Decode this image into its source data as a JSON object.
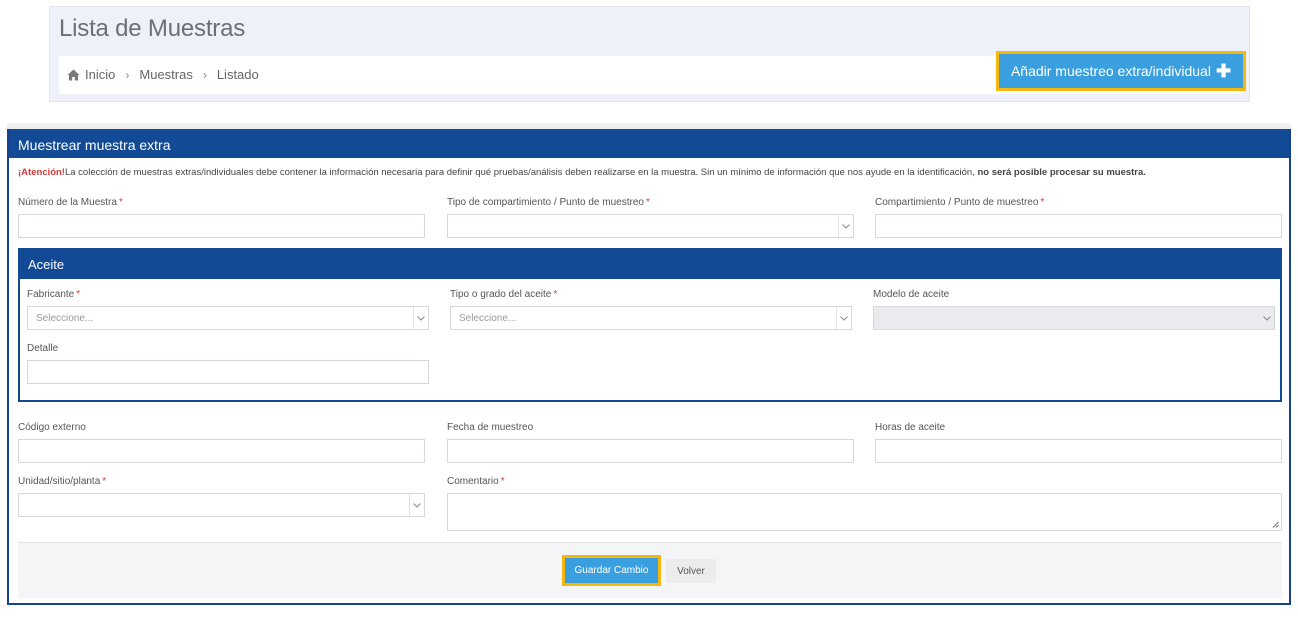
{
  "header": {
    "title": "Lista de Muestras",
    "breadcrumb": [
      "Inicio",
      "Muestras",
      "Listado"
    ],
    "add_button_label": "Añadir muestreo extra/individual",
    "add_button_icon": "plus-icon",
    "accent_color": "#3a9fdf",
    "highlight_color": "#f3b70f"
  },
  "panel": {
    "title": "Muestrear muestra extra",
    "header_color": "#134a95",
    "warning": {
      "attention": "¡Atención!",
      "text": "La colección de muestras extras/individuales debe contener la información necesaria para definir qué pruebas/análisis deben realizarse en la muestra. Sin un mínimo de información que nos ayude en la identificación, ",
      "bold": "no será posible procesar su muestra."
    },
    "fields": {
      "numero_muestra": {
        "label": "Número de la Muestra",
        "required": "*",
        "value": ""
      },
      "tipo_compartimiento": {
        "label": "Tipo de compartimiento / Punto de muestreo",
        "required": "*",
        "value": ""
      },
      "compartimiento": {
        "label": "Compartimiento / Punto de muestreo",
        "required": "*",
        "value": ""
      },
      "codigo_externo": {
        "label": "Código externo",
        "value": ""
      },
      "fecha_muestreo": {
        "label": "Fecha de muestreo",
        "value": ""
      },
      "horas_aceite": {
        "label": "Horas de aceite",
        "value": ""
      },
      "unidad": {
        "label": "Unidad/sitio/planta",
        "required": "*",
        "value": ""
      },
      "comentario": {
        "label": "Comentario",
        "required": "*",
        "value": ""
      }
    },
    "aceite": {
      "title": "Aceite",
      "fabricante": {
        "label": "Fabricante",
        "required": "*",
        "placeholder": "Seleccione..."
      },
      "tipo_grado": {
        "label": "Tipo o grado del aceite",
        "required": "*",
        "placeholder": "Seleccione..."
      },
      "modelo": {
        "label": "Modelo de aceite",
        "value": ""
      },
      "detalle": {
        "label": "Detalle",
        "value": ""
      }
    },
    "footer": {
      "save_label": "Guardar Cambio",
      "back_label": "Volver"
    }
  }
}
